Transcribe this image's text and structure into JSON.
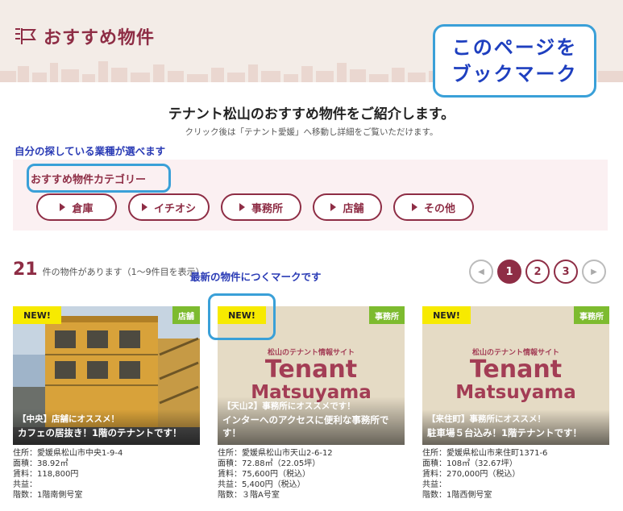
{
  "header": {
    "title": "おすすめ物件",
    "icon": "flag-icon",
    "accent": "#8e2d45"
  },
  "bookmark": {
    "line1": "このページを",
    "line2": "ブックマーク"
  },
  "intro": {
    "title": "テナント松山のおすすめ物件をご紹介します。",
    "subtitle": "クリック後は「テナント愛媛」へ移動し詳細をご覧いただけます。"
  },
  "notes": {
    "category_note": "自分の探している業種が選べます",
    "new_note": "最新の物件につくマークです"
  },
  "category": {
    "label": "おすすめ物件カテゴリー",
    "buttons": [
      {
        "label": "倉庫"
      },
      {
        "label": "イチオシ"
      },
      {
        "label": "事務所"
      },
      {
        "label": "店舗"
      },
      {
        "label": "その他"
      }
    ]
  },
  "results": {
    "count": "21",
    "count_text": "件の物件があります（1〜9件目を表示）"
  },
  "pager": {
    "prev": "◀",
    "pages": [
      "1",
      "2",
      "3"
    ],
    "active": "1",
    "next": "▶"
  },
  "cards": [
    {
      "badge": "NEW!",
      "category": "店舗",
      "caption1": "【中央】店舗にオススメ！",
      "caption2": "カフェの居抜き！1階のテナントです！",
      "info": [
        "住所：愛媛県松山市中央1-9-4",
        "面積：38.92㎡",
        "賃料：118,800円",
        "共益：",
        "階数：1階南側号室"
      ]
    },
    {
      "badge": "NEW!",
      "category": "事務所",
      "logo_small": "松山のテナント情報サイト",
      "logo_big": "Tenant",
      "logo_mid": "Matsuyama",
      "caption1": "【天山2】事務所にオススメです！",
      "caption2": "インターへのアクセスに便利な事務所です！",
      "info": [
        "住所：愛媛県松山市天山2-6-12",
        "面積：72.88㎡（22.05坪）",
        "賃料：75,600円（税込）",
        "共益：5,400円（税込）",
        "階数：３階A号室"
      ]
    },
    {
      "badge": "NEW!",
      "category": "事務所",
      "logo_small": "松山のテナント情報サイト",
      "logo_big": "Tenant",
      "logo_mid": "Matsuyama",
      "caption1": "【来住町】事務所にオススメ！",
      "caption2": "駐車場５台込み！1階テナントです！",
      "info": [
        "住所：愛媛県松山市来住町1371-6",
        "面積：108㎡（32.67坪）",
        "賃料：270,000円（税込）",
        "共益：",
        "階数：1階西側号室"
      ]
    }
  ]
}
